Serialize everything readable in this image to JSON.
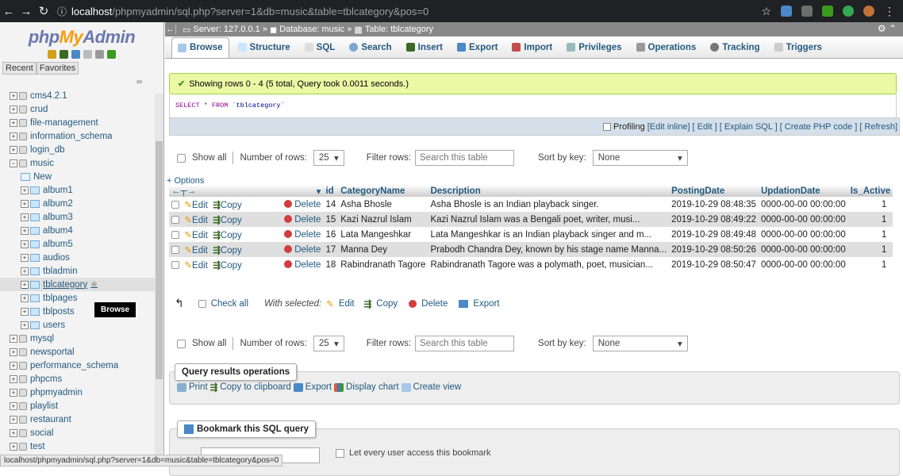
{
  "browser": {
    "url_host": "localhost",
    "url_rest": "/phpmyadmin/sql.php?server=1&db=music&table=tblcategory&pos=0"
  },
  "sidebar": {
    "logo_php": "php",
    "logo_my": "My",
    "logo_admin": "Admin",
    "recent": "Recent",
    "favorites": "Favorites",
    "tooltip": "Browse",
    "databases": [
      {
        "name": "cms4.2.1",
        "expanded": false
      },
      {
        "name": "crud",
        "expanded": false
      },
      {
        "name": "file-management",
        "expanded": false
      },
      {
        "name": "information_schema",
        "expanded": false
      },
      {
        "name": "login_db",
        "expanded": false
      },
      {
        "name": "music",
        "expanded": true
      }
    ],
    "music_children": [
      "New",
      "album1",
      "album2",
      "album3",
      "album4",
      "album5",
      "audios",
      "tbladmin",
      "tblcategory",
      "tblpages",
      "tblposts",
      "users"
    ],
    "databases_after": [
      "mysql",
      "newsportal",
      "performance_schema",
      "phpcms",
      "phpmyadmin",
      "playlist",
      "restaurant",
      "social",
      "test"
    ]
  },
  "breadcrumb": {
    "server": "Server: 127.0.0.1",
    "database": "Database: music",
    "table": "Table: tblcategory"
  },
  "tabs": [
    "Browse",
    "Structure",
    "SQL",
    "Search",
    "Insert",
    "Export",
    "Import",
    "Privileges",
    "Operations",
    "Tracking",
    "Triggers"
  ],
  "success_message": "Showing rows 0 - 4 (5 total, Query took 0.0011 seconds.)",
  "sql": {
    "select": "SELECT",
    "star": " * ",
    "from": "FROM",
    "table": " `tblcategory`"
  },
  "profiling": {
    "label": "Profiling",
    "links": [
      "[Edit inline]",
      "[ Edit ]",
      "[ Explain SQL ]",
      "[ Create PHP code ]",
      "[ Refresh]"
    ]
  },
  "nav": {
    "show_all": "Show all",
    "num_rows_label": "Number of rows:",
    "num_rows": "25",
    "filter_label": "Filter rows:",
    "filter_placeholder": "Search this table",
    "sort_label": "Sort by key:",
    "sort_value": "None"
  },
  "options_link": "+ Options",
  "columns": [
    "id",
    "CategoryName",
    "Description",
    "PostingDate",
    "UpdationDate",
    "Is_Active"
  ],
  "row_actions": {
    "edit": "Edit",
    "copy": "Copy",
    "delete": "Delete"
  },
  "rows": [
    {
      "id": "14",
      "name": "Asha Bhosle",
      "desc": "Asha Bhosle is an Indian playback singer.",
      "posting": "2019-10-29 08:48:35",
      "updation": "0000-00-00 00:00:00",
      "active": "1"
    },
    {
      "id": "15",
      "name": "Kazi Nazrul Islam",
      "desc": "Kazi Nazrul Islam was a Bengali poet, writer, musi...",
      "posting": "2019-10-29 08:49:22",
      "updation": "0000-00-00 00:00:00",
      "active": "1"
    },
    {
      "id": "16",
      "name": "Lata Mangeshkar",
      "desc": "Lata Mangeshkar is an Indian playback singer and m...",
      "posting": "2019-10-29 08:49:48",
      "updation": "0000-00-00 00:00:00",
      "active": "1"
    },
    {
      "id": "17",
      "name": "Manna Dey",
      "desc": "Prabodh Chandra Dey, known by his stage name Manna...",
      "posting": "2019-10-29 08:50:26",
      "updation": "0000-00-00 00:00:00",
      "active": "1"
    },
    {
      "id": "18",
      "name": "Rabindranath Tagore",
      "desc": "Rabindranath Tagore was a polymath, poet, musician...",
      "posting": "2019-10-29 08:50:47",
      "updation": "0000-00-00 00:00:00",
      "active": "1"
    }
  ],
  "bulk": {
    "check_all": "Check all",
    "with_selected": "With selected:",
    "edit": "Edit",
    "copy": "Copy",
    "delete": "Delete",
    "export": "Export"
  },
  "query_ops": {
    "legend": "Query results operations",
    "print": "Print",
    "copy": "Copy to clipboard",
    "export": "Export",
    "chart": "Display chart",
    "view": "Create view"
  },
  "bookmark": {
    "legend": "Bookmark this SQL query",
    "let_every_user": "Let every user access this bookmark"
  },
  "status_url": "localhost/phpmyadmin/sql.php?server=1&db=music&table=tblcategory&pos=0"
}
